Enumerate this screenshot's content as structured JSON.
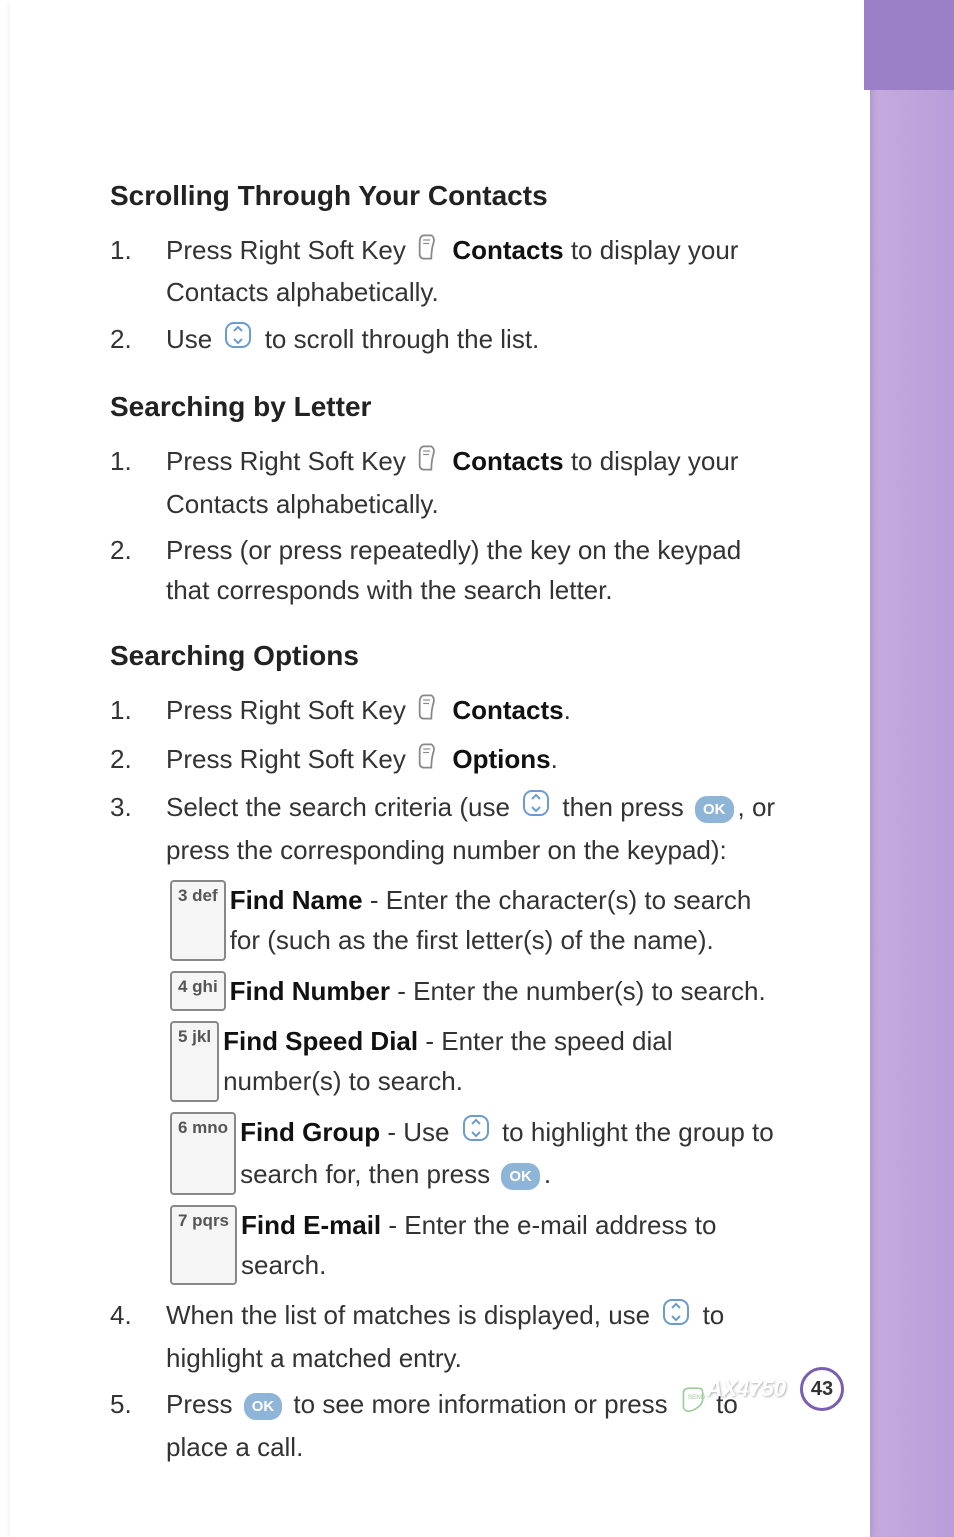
{
  "h1": "Scrolling Through Your Contacts",
  "s1": [
    {
      "n": "1.",
      "pre": "Press Right Soft Key ",
      "icon": "soft",
      "bold": "Contacts",
      "post": " to display your Contacts alphabetically."
    },
    {
      "n": "2.",
      "pre": "Use ",
      "icon": "nav",
      "post": " to scroll through the list."
    }
  ],
  "h2": "Searching by Letter",
  "s2": [
    {
      "n": "1.",
      "pre": "Press Right Soft Key ",
      "icon": "soft",
      "bold": "Contacts",
      "post": " to display your Contacts alphabetically."
    },
    {
      "n": "2.",
      "text": "Press (or press repeatedly) the key on the keypad that corresponds with the search letter."
    }
  ],
  "h3": "Searching Options",
  "s3": [
    {
      "n": "1.",
      "pre": "Press Right Soft Key ",
      "icon": "soft",
      "bold": "Contacts",
      "post": "."
    },
    {
      "n": "2.",
      "pre": "Press Right Soft Key ",
      "icon": "soft",
      "bold": "Options",
      "post": "."
    }
  ],
  "s3_3": {
    "n": "3.",
    "pre": "Select the search criteria (use ",
    "mid": " then press ",
    "post": ", or press the corresponding number on the keypad):"
  },
  "subs": [
    {
      "k": "3 def",
      "b": "Find Name",
      "t": " - Enter the character(s) to search for (such as the first letter(s) of the name)."
    },
    {
      "k": "4 ghi",
      "b": "Find Number",
      "t": " - Enter the number(s) to search."
    },
    {
      "k": "5 jkl",
      "b": "Find Speed Dial",
      "t": "  - Enter the speed dial number(s) to search."
    },
    {
      "k": "6 mno",
      "b": "Find Group",
      "t1": " - Use ",
      "t2": " to highlight the group to search for, then press ",
      "t3": "."
    },
    {
      "k": "7 pqrs",
      "b": "Find E-mail",
      "t": " - Enter the e-mail address to search."
    }
  ],
  "s3_4": {
    "n": "4.",
    "pre": "When the list of matches is displayed, use ",
    "post": " to highlight a matched entry."
  },
  "s3_5": {
    "n": "5.",
    "pre": "Press ",
    "mid": " to see more information or press ",
    "post": " to place a call."
  },
  "ok": "OK",
  "model": "AX4750",
  "page": "43"
}
